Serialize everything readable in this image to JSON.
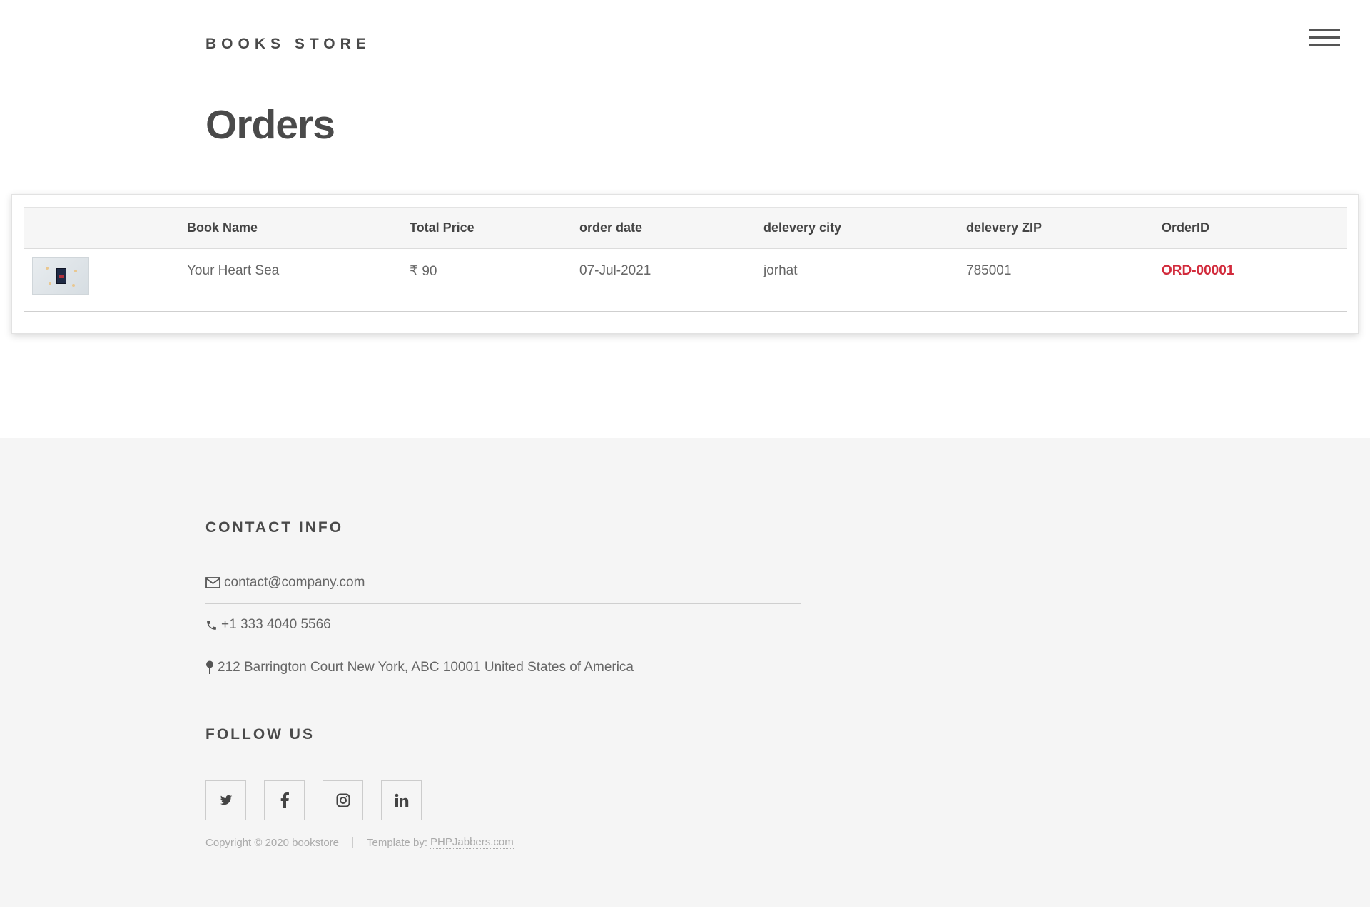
{
  "header": {
    "brand": "BOOKS STORE",
    "page_title": "Orders"
  },
  "table": {
    "columns": [
      "",
      "Book Name",
      "Total Price",
      "order date",
      "delevery city",
      "delevery ZIP",
      "OrderID"
    ],
    "rows": [
      {
        "book_name": "Your Heart Sea",
        "total_price": "₹ 90",
        "order_date": "07-Jul-2021",
        "city": "jorhat",
        "zip": "785001",
        "order_id": "ORD-00001"
      }
    ]
  },
  "footer": {
    "contact_heading": "CONTACT INFO",
    "email": "contact@company.com",
    "phone": "+1 333 4040 5566",
    "address": "212 Barrington Court New York, ABC 10001 United States of America",
    "follow_heading": "FOLLOW US",
    "social": [
      "twitter-icon",
      "facebook-icon",
      "instagram-icon",
      "linkedin-icon"
    ],
    "copyright": "Copyright © 2020 bookstore",
    "template_prefix": "Template by:",
    "template_link": "PHPJabbers.com"
  },
  "colors": {
    "accent": "#d22b3c",
    "text": "#555555",
    "footer_bg": "#f5f5f5"
  }
}
